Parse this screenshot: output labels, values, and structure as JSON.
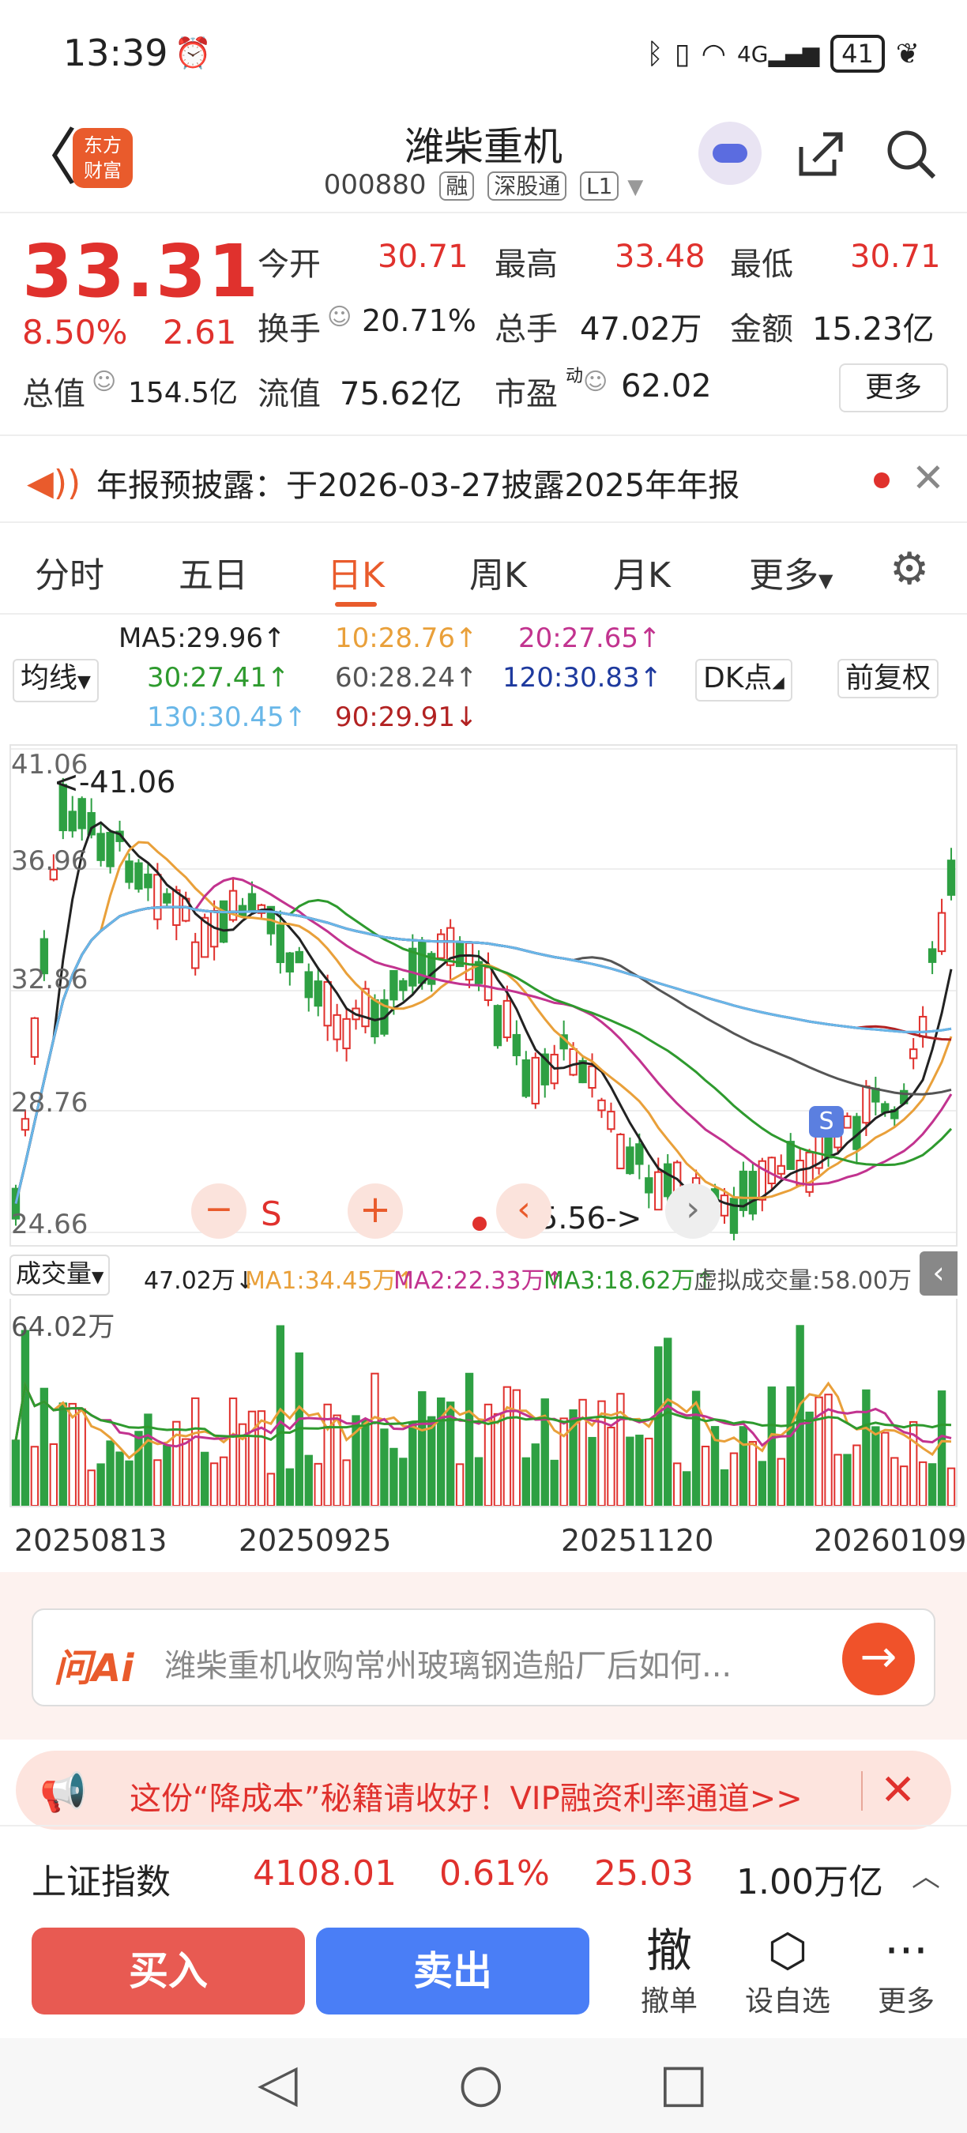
{
  "status": {
    "time": "13:39",
    "alarm_icon": "alarm-icon",
    "net": "4G",
    "battery": "41"
  },
  "header": {
    "back": "〈",
    "logo": "东方\n财富",
    "logo_line1": "东方",
    "logo_line2": "财富",
    "title": "潍柴重机",
    "code": "000880",
    "tags": [
      "融",
      "深股通",
      "L1"
    ]
  },
  "quote": {
    "price": "33.31",
    "pct": "8.50%",
    "chg": "2.61",
    "open_label": "今开",
    "open": "30.71",
    "high_label": "最高",
    "high": "33.48",
    "low_label": "最低",
    "low": "30.71",
    "turnover_label": "换手",
    "turnover": "20.71%",
    "volume_label": "总手",
    "volume": "47.02万",
    "amount_label": "金额",
    "amount": "15.23亿",
    "mcap_label": "总值",
    "mcap": "154.5亿",
    "float_label": "流值",
    "float": "75.62亿",
    "pe_label": "市盈",
    "pe_sup": "动",
    "pe": "62.02",
    "more": "更多"
  },
  "notice": {
    "text": "年报预披露：于2026-03-27披露2025年年报"
  },
  "tabs": [
    "分时",
    "五日",
    "日K",
    "周K",
    "月K",
    "更多"
  ],
  "active_tab": 2,
  "ma": {
    "indicator": "均线",
    "ma5": "MA5:29.96↑",
    "ma10": "10:28.76↑",
    "ma20": "20:27.65↑",
    "ma30": "30:27.41↑",
    "ma60": "60:28.24↑",
    "ma120": "120:30.83↑",
    "ma130": "130:30.45↑",
    "ma90": "90:29.91↓",
    "dk": "DK点",
    "adjust": "前复权"
  },
  "chart_data": {
    "type": "candlestick",
    "y_ticks": [
      "41.06",
      "36.96",
      "32.86",
      "28.76",
      "24.66"
    ],
    "annotations": [
      "<-41.06",
      "25.56->"
    ],
    "ylim": [
      24.66,
      41.06
    ],
    "volume": {
      "label": "成交量",
      "current": "47.02万↓",
      "ma1": "MA1:34.45万↑",
      "ma2": "MA2:22.33万↑",
      "ma3": "MA3:18.62万↑",
      "virtual": "虚拟成交量:58.00万",
      "ymax_label": "64.02万"
    },
    "dates": [
      "20250813",
      "20250925",
      "20251120",
      "20260109"
    ]
  },
  "chart_tools": {
    "minus": "−",
    "sell_marker": "S",
    "plus": "+",
    "s_badge": "S"
  },
  "ai": {
    "logo": "问Ai",
    "query": "潍柴重机收购常州玻璃钢造船厂后如何..."
  },
  "promo": {
    "text": "这份“降成本”秘籍请收好！VIP融资利率通道>>"
  },
  "index": {
    "name": "上证指数",
    "value": "4108.01",
    "pct": "0.61%",
    "chg": "25.03",
    "amount": "1.00万亿"
  },
  "trade": {
    "buy": "买入",
    "sell": "卖出",
    "cancel_icon": "撤",
    "cancel": "撤单",
    "watch": "设自选",
    "more": "更多"
  },
  "colors": {
    "up": "#e0312d",
    "down": "#2ea043",
    "accent": "#e95b2c",
    "sell_btn": "#4a7ef6"
  }
}
